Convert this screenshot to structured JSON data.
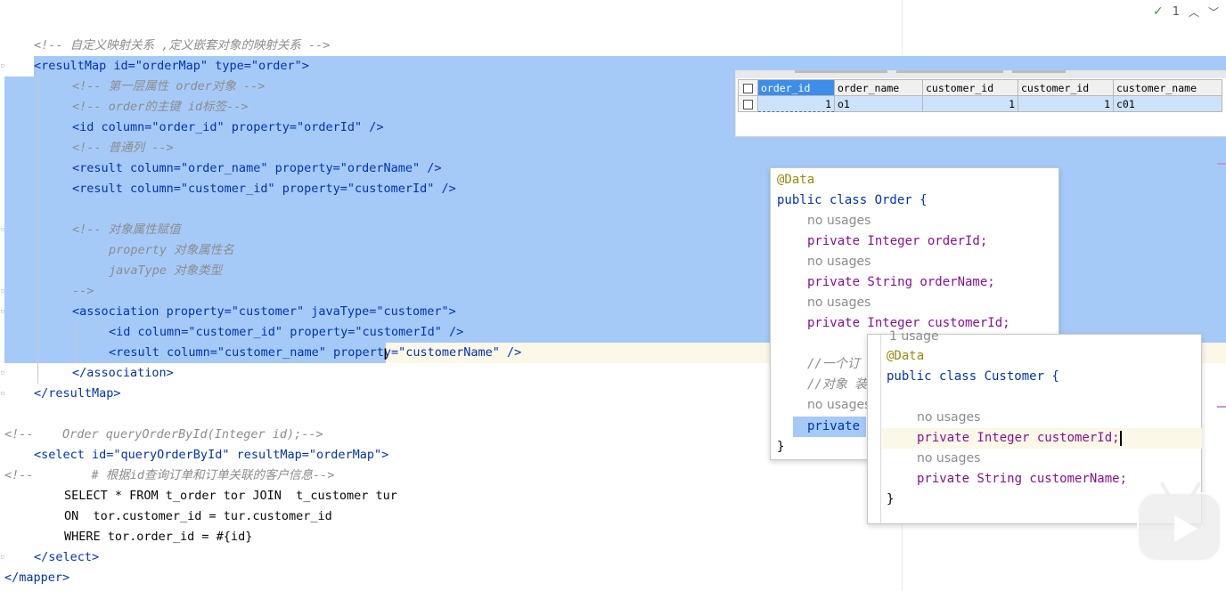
{
  "status": {
    "problems_count": "1"
  },
  "xml_lines": [
    "<!-- 自定义映射关系 ,定义嵌套对象的映射关系 -->",
    "<resultMap id=\"orderMap\" type=\"order\">",
    "<!-- 第一层属性 order对象 -->",
    "<!-- order的主键 id标签-->",
    "<id column=\"order_id\" property=\"orderId\" />",
    "<!-- 普通列 -->",
    "<result column=\"order_name\" property=\"orderName\" />",
    "<result column=\"customer_id\" property=\"customerId\" />",
    "",
    "<!-- 对象属性赋值",
    "property 对象属性名",
    "javaType 对象类型",
    "-->",
    "<association property=\"customer\" javaType=\"customer\">",
    "<id column=\"customer_id\" property=\"customerId\" />",
    "<result column=\"customer_name\" property=\"customerName\" />",
    "</association>",
    "</resultMap>",
    "",
    "<!--    Order queryOrderById(Integer id);-->",
    "<select id=\"queryOrderById\" resultMap=\"orderMap\">",
    "<!--        # 根据id查询订单和订单关联的客户信息-->",
    "SELECT * FROM t_order tor JOIN  t_customer tur",
    "ON  tor.customer_id = tur.customer_id",
    "WHERE tor.order_id = #{id}",
    "</select>",
    "</mapper>"
  ],
  "result_table": {
    "columns": [
      "order_id",
      "order_name",
      "customer_id",
      "customer_id",
      "customer_name"
    ],
    "rows": [
      [
        "1",
        "o1",
        "1",
        "1",
        "c01"
      ]
    ]
  },
  "order_popup": {
    "lines": [
      "@Data",
      "public class Order {",
      "no usages",
      "private Integer orderId;",
      "no usages",
      "private String orderName;",
      "no usages",
      "private Integer customerId;",
      "",
      "//一个订",
      "//对象 装",
      "no usages",
      "private",
      "}"
    ]
  },
  "customer_popup": {
    "lines": [
      "1 usage",
      "@Data",
      "public class Customer {",
      "",
      "no usages",
      "private Integer customerId;",
      "no usages",
      "private String customerName;",
      "}"
    ]
  }
}
